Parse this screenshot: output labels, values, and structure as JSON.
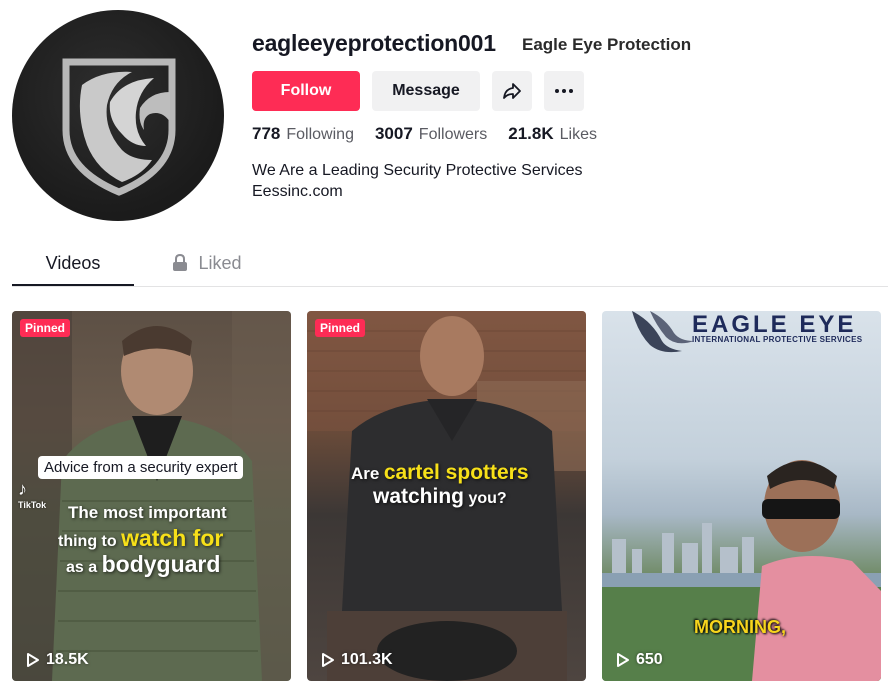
{
  "profile": {
    "username": "eagleeyeprotection001",
    "nickname": "Eagle Eye Protection",
    "avatar_icon": "eagle-shield-logo",
    "follow_label": "Follow",
    "message_label": "Message",
    "share_icon": "share-icon",
    "more_icon": "more-dots-icon",
    "stats": [
      {
        "value": "778",
        "label": "Following"
      },
      {
        "value": "3007",
        "label": "Followers"
      },
      {
        "value": "21.8K",
        "label": "Likes"
      }
    ],
    "bio_lines": [
      "We Are a Leading Security Protective Services",
      "Eessinc.com"
    ]
  },
  "tabs": [
    {
      "label": "Videos",
      "active": true
    },
    {
      "label": "Liked",
      "active": false,
      "icon": "lock-icon"
    }
  ],
  "videos": [
    {
      "pinned": true,
      "pinned_label": "Pinned",
      "views": "18.5K",
      "caption_box": "Advice from a security expert",
      "overlay_line1_white": "The most important",
      "overlay_line2_white": "thing to",
      "overlay_line2_yellow": "watch for",
      "overlay_line3_white": "as a",
      "overlay_line3_bold": "bodyguard",
      "watermark": "TikTok"
    },
    {
      "pinned": true,
      "pinned_label": "Pinned",
      "views": "101.3K",
      "overlay_line1_white": "Are",
      "overlay_line1_yellow": "cartel spotters",
      "overlay_line2_white": "watching",
      "overlay_line2_small": "you?"
    },
    {
      "pinned": false,
      "views": "650",
      "brand_name": "EAGLE EYE",
      "brand_sub": "INTERNATIONAL PROTECTIVE SERVICES",
      "subtitle": "MORNING,"
    }
  ],
  "colors": {
    "accent": "#fe2c55",
    "text": "#161823",
    "muted": "#8a8b91",
    "button_bg": "#f1f1f2",
    "highlight_yellow": "#f7e019"
  }
}
